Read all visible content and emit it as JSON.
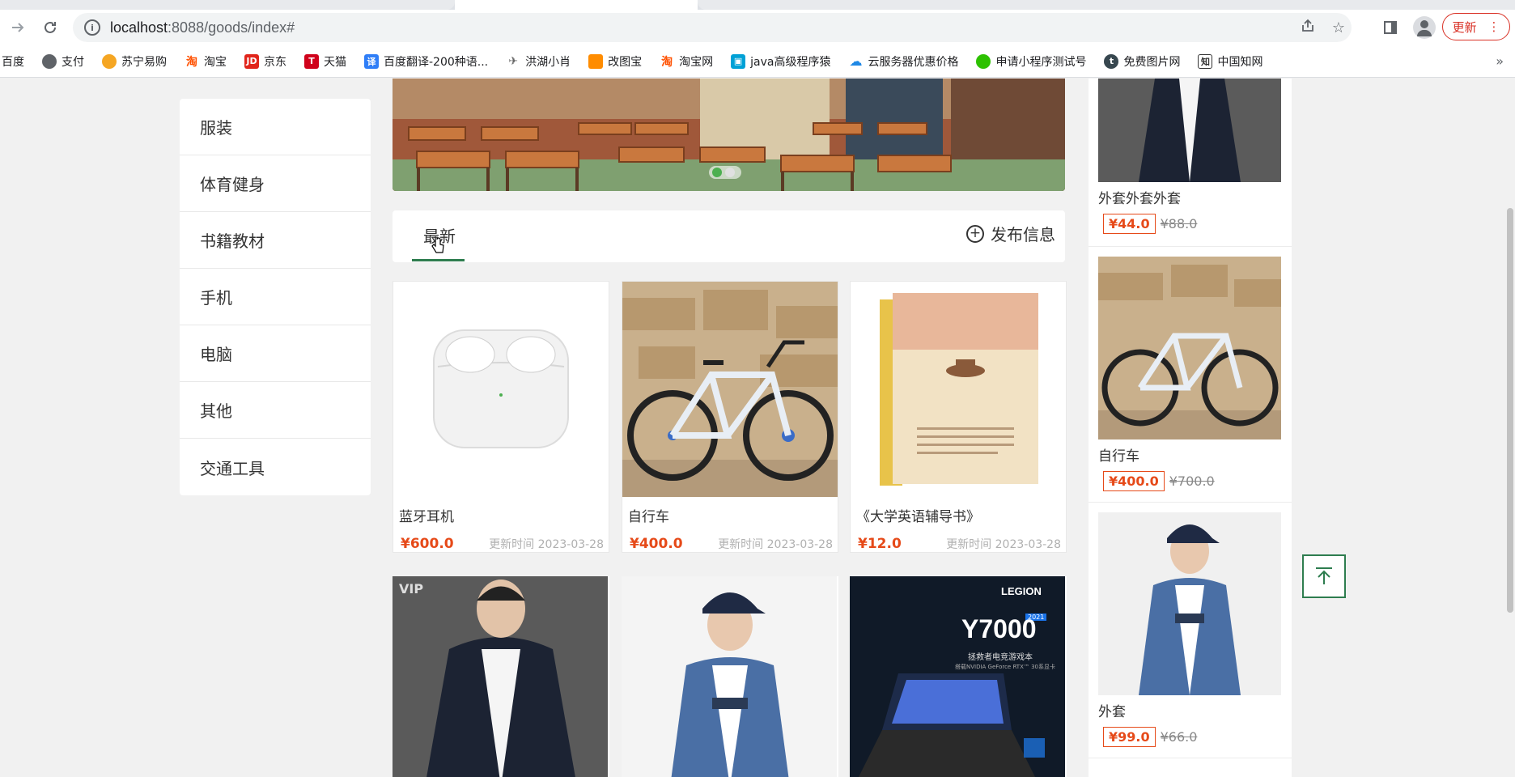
{
  "browser": {
    "url_host": "localhost",
    "url_path": ":8088/goods/index#",
    "update_label": "更新"
  },
  "bookmarks": [
    {
      "label": "百度",
      "icon": "baidu-icon",
      "color": "#ffffff"
    },
    {
      "label": "支付",
      "icon": "globe-icon",
      "color": "#5f6368"
    },
    {
      "label": "苏宁易购",
      "icon": "suning-icon",
      "color": "#f5a623"
    },
    {
      "label": "淘宝",
      "icon": "taobao-icon",
      "color": "#ff5000"
    },
    {
      "label": "京东",
      "icon": "jd-icon",
      "color": "#e1251b"
    },
    {
      "label": "天猫",
      "icon": "tmall-icon",
      "color": "#d0021b"
    },
    {
      "label": "百度翻译-200种语...",
      "icon": "translate-icon",
      "color": "#2f7ef7"
    },
    {
      "label": "洪湖小肖",
      "icon": "bird-icon",
      "color": "#666666"
    },
    {
      "label": "改图宝",
      "icon": "image-tool-icon",
      "color": "#ff8c00"
    },
    {
      "label": "淘宝网",
      "icon": "taobao-icon",
      "color": "#ff5000"
    },
    {
      "label": "java高级程序猿",
      "icon": "bilibili-icon",
      "color": "#00a1d6"
    },
    {
      "label": "云服务器优惠价格",
      "icon": "cloud-icon",
      "color": "#1e88e5"
    },
    {
      "label": "申请小程序测试号",
      "icon": "wechat-icon",
      "color": "#2dc100"
    },
    {
      "label": "免费图片网",
      "icon": "t-icon",
      "color": "#37474f"
    },
    {
      "label": "中国知网",
      "icon": "cnki-icon",
      "color": "#333333"
    }
  ],
  "categories": [
    "服装",
    "体育健身",
    "书籍教材",
    "手机",
    "电脑",
    "其他",
    "交通工具"
  ],
  "tabs": {
    "latest": "最新",
    "publish": "发布信息"
  },
  "products": [
    {
      "title": "蓝牙耳机",
      "price": "¥600.0",
      "time": "更新时间 2023-03-28",
      "image": "earbuds"
    },
    {
      "title": "自行车",
      "price": "¥400.0",
      "time": "更新时间 2023-03-28",
      "image": "bicycle"
    },
    {
      "title": "《大学英语辅导书》",
      "price": "¥12.0",
      "time": "更新时间 2023-03-28",
      "image": "book"
    }
  ],
  "products_row2": [
    {
      "image": "jacket-dark",
      "badge": "VIP"
    },
    {
      "image": "jacket-blue"
    },
    {
      "image": "laptop",
      "brand": "LEGION",
      "model": "Y7000",
      "year": "2021",
      "tagline": "拯救者电竞游戏本",
      "sub": "搭载NVIDIA GeForce RTX™ 30系显卡"
    }
  ],
  "recommend": [
    {
      "title": "外套外套外套",
      "price": "¥44.0",
      "old_price": "¥88.0",
      "image": "jacket-dark"
    },
    {
      "title": "自行车",
      "price": "¥400.0",
      "old_price": "¥700.0",
      "image": "bicycle"
    },
    {
      "title": "外套",
      "price": "¥99.0",
      "old_price": "¥66.0",
      "image": "jacket-blue"
    }
  ],
  "colors": {
    "accent_green": "#2e7d4f",
    "price_red": "#e64a19"
  }
}
